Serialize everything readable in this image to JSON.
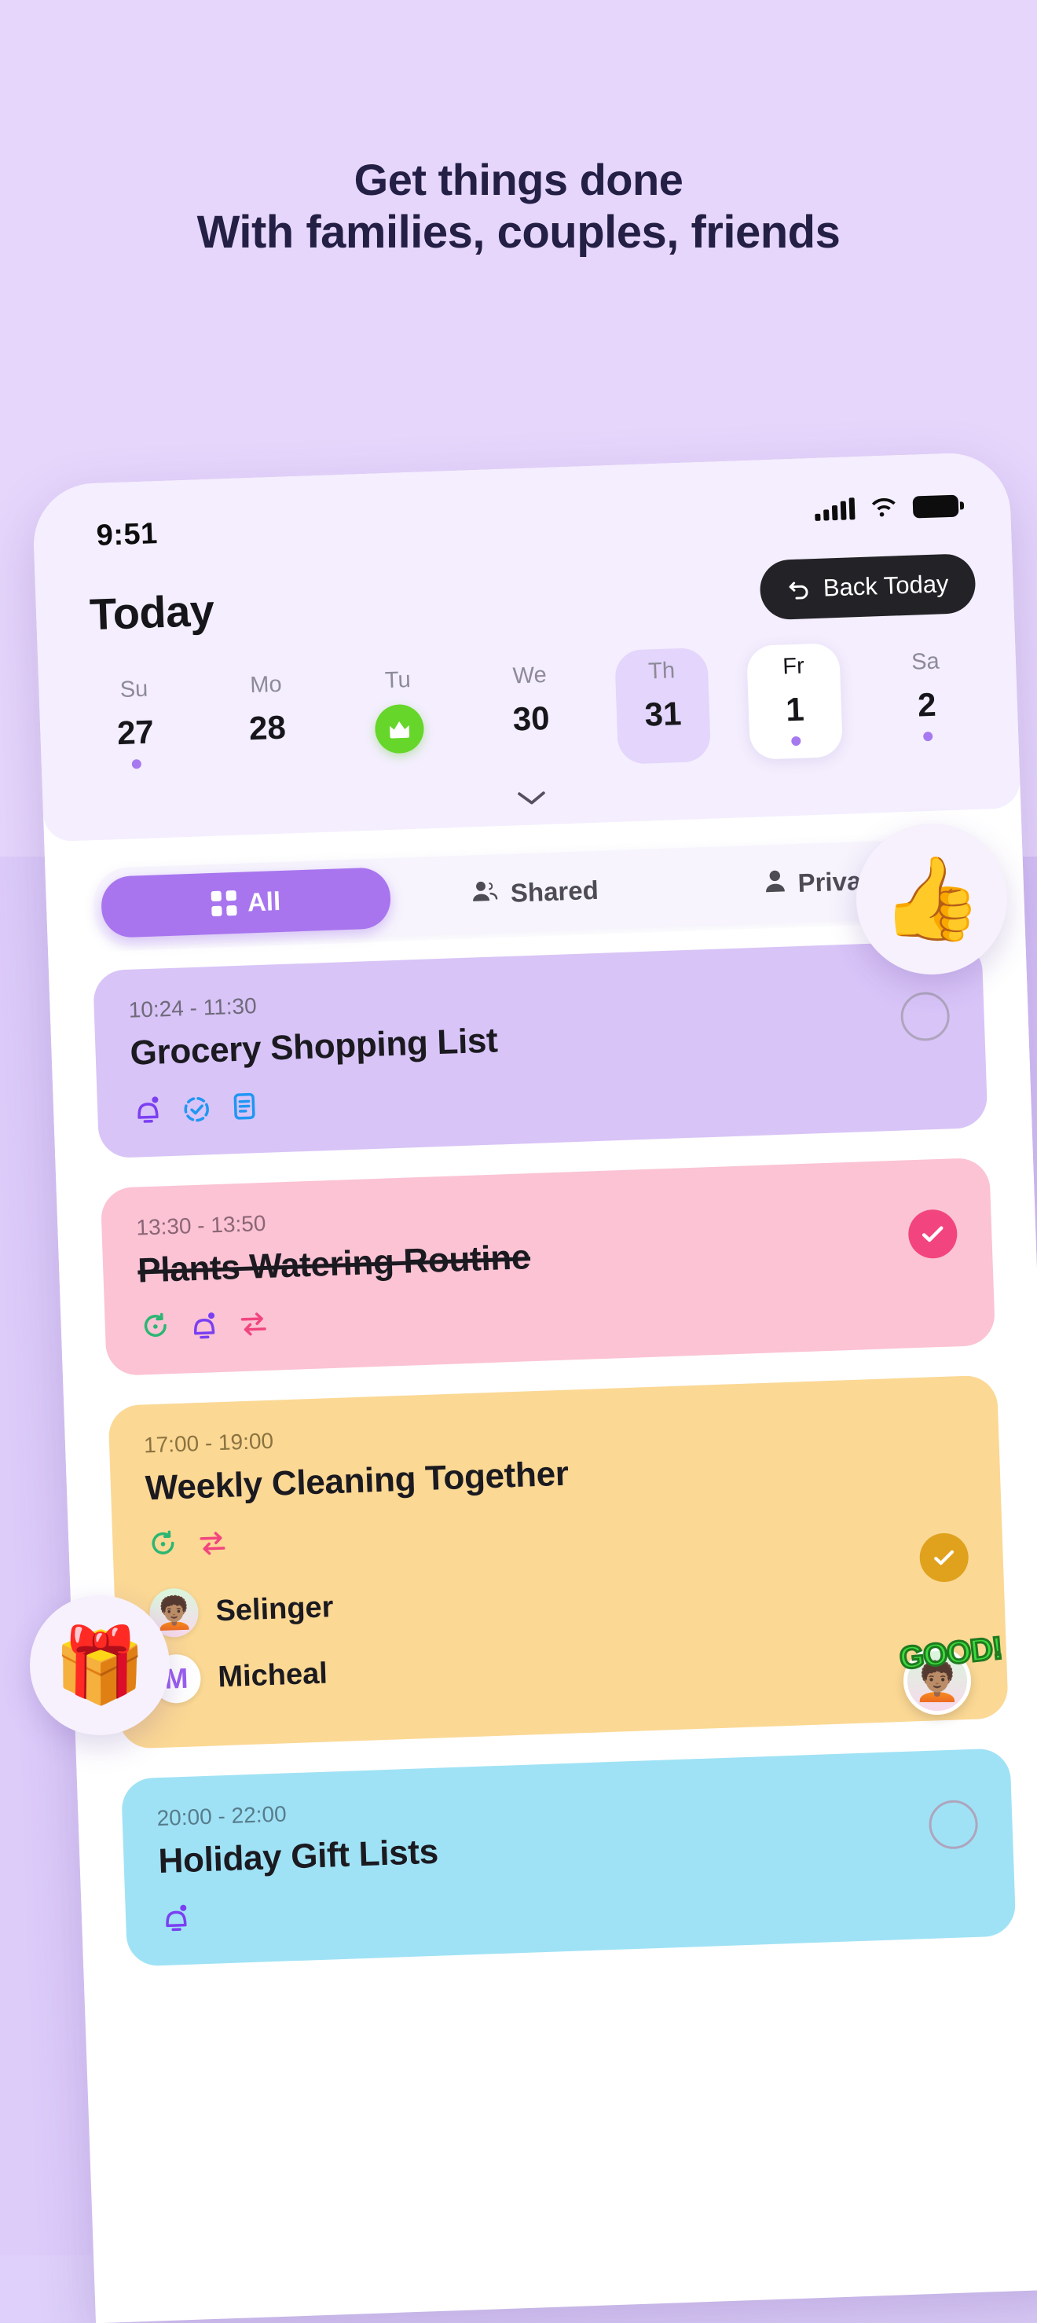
{
  "hero": {
    "line1": "Get things done",
    "line2": "With families, couples, friends"
  },
  "colors": {
    "page_bg": "#e3d2fb",
    "headline": "#241f45",
    "accent_purple": "#a875ef",
    "card_purple": "#d8c4f7",
    "card_pink": "#fbc3d4",
    "card_yellow": "#fbd894",
    "card_blue": "#9fe2f5",
    "green_badge": "#66d62a",
    "pink_check": "#f2457f",
    "amber_check": "#e0a11d"
  },
  "phone": {
    "status": {
      "time": "9:51",
      "signal_icon": "signal-bars-icon",
      "wifi_icon": "wifi-icon",
      "battery_icon": "battery-icon"
    },
    "header": {
      "title": "Today",
      "back_button_label": "Back Today",
      "back_button_icon": "undo-arrow-icon",
      "expand_icon": "chevron-down-icon"
    },
    "week": [
      {
        "dow": "Su",
        "num": "27",
        "dot": true,
        "state": "normal",
        "badge": null
      },
      {
        "dow": "Mo",
        "num": "28",
        "dot": false,
        "state": "normal",
        "badge": null
      },
      {
        "dow": "Tu",
        "num": "",
        "dot": false,
        "state": "normal",
        "badge": "crown-icon"
      },
      {
        "dow": "We",
        "num": "30",
        "dot": false,
        "state": "normal",
        "badge": null
      },
      {
        "dow": "Th",
        "num": "31",
        "dot": false,
        "state": "highlight",
        "badge": null
      },
      {
        "dow": "Fr",
        "num": "1",
        "dot": true,
        "state": "selected",
        "badge": null
      },
      {
        "dow": "Sa",
        "num": "2",
        "dot": true,
        "state": "normal",
        "badge": null
      }
    ],
    "tabs": [
      {
        "label": "All",
        "icon": "grid-icon",
        "active": true
      },
      {
        "label": "Shared",
        "icon": "people-icon",
        "active": false
      },
      {
        "label": "Private",
        "icon": "person-icon",
        "active": false
      }
    ],
    "tasks": [
      {
        "time": "10:24 - 11:30",
        "title": "Grocery Shopping List",
        "done": false,
        "color": "c-purple",
        "check": "empty",
        "icons": [
          "bell-icon",
          "check-circle-dashed-icon",
          "notes-icon"
        ],
        "members": []
      },
      {
        "time": "13:30 - 13:50",
        "title": "Plants Watering Routine",
        "done": true,
        "color": "c-pink",
        "check": "pink",
        "icons": [
          "repeat-icon",
          "bell-icon",
          "swap-icon"
        ],
        "members": []
      },
      {
        "time": "17:00 - 19:00",
        "title": "Weekly Cleaning Together",
        "done": false,
        "color": "c-yellow",
        "check": "amber",
        "icons": [
          "repeat-icon",
          "swap-icon"
        ],
        "members": [
          {
            "name": "Selinger",
            "avatar_type": "emoji",
            "avatar_value": "🧑🏽‍🦱"
          },
          {
            "name": "Micheal",
            "avatar_type": "initial",
            "avatar_value": "M"
          }
        ]
      },
      {
        "time": "20:00 - 22:00",
        "title": "Holiday Gift Lists",
        "done": false,
        "color": "c-blue",
        "check": "empty",
        "icons": [
          "bell-icon"
        ],
        "members": []
      }
    ]
  },
  "stickers": {
    "thumbs_up": "👍",
    "gift": "🎁",
    "reaction_avatar": "🧑🏽‍🦱",
    "reaction_label": "GOOD!"
  }
}
